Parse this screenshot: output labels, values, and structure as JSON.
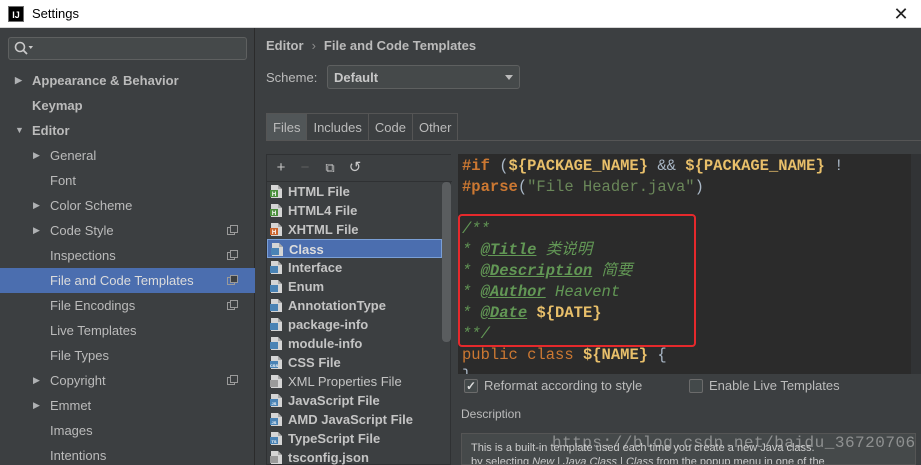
{
  "window": {
    "title": "Settings",
    "app_icon": "intellij-icon",
    "close_icon": "close-icon"
  },
  "search": {
    "placeholder": "",
    "icon": "search-icon"
  },
  "nav": {
    "items": [
      {
        "label": "Appearance & Behavior",
        "bold": true,
        "arrow": "right",
        "level": 0,
        "selected": false,
        "project_icon": false
      },
      {
        "label": "Keymap",
        "bold": true,
        "arrow": "",
        "level": 0,
        "selected": false,
        "project_icon": false
      },
      {
        "label": "Editor",
        "bold": true,
        "arrow": "down",
        "level": 0,
        "selected": false,
        "project_icon": false
      },
      {
        "label": "General",
        "bold": false,
        "arrow": "right",
        "level": 1,
        "selected": false,
        "project_icon": false
      },
      {
        "label": "Font",
        "bold": false,
        "arrow": "",
        "level": 1,
        "selected": false,
        "project_icon": false
      },
      {
        "label": "Color Scheme",
        "bold": false,
        "arrow": "right",
        "level": 1,
        "selected": false,
        "project_icon": false
      },
      {
        "label": "Code Style",
        "bold": false,
        "arrow": "right",
        "level": 1,
        "selected": false,
        "project_icon": true
      },
      {
        "label": "Inspections",
        "bold": false,
        "arrow": "",
        "level": 1,
        "selected": false,
        "project_icon": true
      },
      {
        "label": "File and Code Templates",
        "bold": false,
        "arrow": "",
        "level": 1,
        "selected": true,
        "project_icon": true
      },
      {
        "label": "File Encodings",
        "bold": false,
        "arrow": "",
        "level": 1,
        "selected": false,
        "project_icon": true
      },
      {
        "label": "Live Templates",
        "bold": false,
        "arrow": "",
        "level": 1,
        "selected": false,
        "project_icon": false
      },
      {
        "label": "File Types",
        "bold": false,
        "arrow": "",
        "level": 1,
        "selected": false,
        "project_icon": false
      },
      {
        "label": "Copyright",
        "bold": false,
        "arrow": "right",
        "level": 1,
        "selected": false,
        "project_icon": true
      },
      {
        "label": "Emmet",
        "bold": false,
        "arrow": "right",
        "level": 1,
        "selected": false,
        "project_icon": false
      },
      {
        "label": "Images",
        "bold": false,
        "arrow": "",
        "level": 1,
        "selected": false,
        "project_icon": false
      },
      {
        "label": "Intentions",
        "bold": false,
        "arrow": "",
        "level": 1,
        "selected": false,
        "project_icon": false
      }
    ]
  },
  "breadcrumb": {
    "part1": "Editor",
    "separator": "›",
    "part2": "File and Code Templates"
  },
  "scheme": {
    "label": "Scheme:",
    "value": "Default"
  },
  "tabs": [
    {
      "label": "Files",
      "active": true
    },
    {
      "label": "Includes",
      "active": false
    },
    {
      "label": "Code",
      "active": false
    },
    {
      "label": "Other",
      "active": false
    }
  ],
  "list_toolbar": {
    "add": "+",
    "remove": "−",
    "copy": "⧉",
    "reset": "↺"
  },
  "templates": [
    {
      "label": "HTML File",
      "icon": "html-file-icon",
      "color": "#4a8f3c",
      "tag": "H",
      "bold": true,
      "selected": false
    },
    {
      "label": "HTML4 File",
      "icon": "html4-file-icon",
      "color": "#4a8f3c",
      "tag": "H",
      "bold": true,
      "selected": false
    },
    {
      "label": "XHTML File",
      "icon": "xhtml-file-icon",
      "color": "#c9632d",
      "tag": "H",
      "bold": true,
      "selected": false
    },
    {
      "label": "Class",
      "icon": "class-file-icon",
      "color": "#4a83b5",
      "tag": "",
      "bold": true,
      "selected": true
    },
    {
      "label": "Interface",
      "icon": "interface-file-icon",
      "color": "#4a83b5",
      "tag": "",
      "bold": true,
      "selected": false
    },
    {
      "label": "Enum",
      "icon": "enum-file-icon",
      "color": "#4a83b5",
      "tag": "",
      "bold": true,
      "selected": false
    },
    {
      "label": "AnnotationType",
      "icon": "annotation-file-icon",
      "color": "#4a83b5",
      "tag": "",
      "bold": true,
      "selected": false
    },
    {
      "label": "package-info",
      "icon": "package-info-icon",
      "color": "#4a83b5",
      "tag": "",
      "bold": true,
      "selected": false
    },
    {
      "label": "module-info",
      "icon": "module-info-icon",
      "color": "#4a83b5",
      "tag": "",
      "bold": true,
      "selected": false
    },
    {
      "label": "CSS File",
      "icon": "css-file-icon",
      "color": "#4a83b5",
      "tag": "CSS",
      "bold": true,
      "selected": false
    },
    {
      "label": "XML Properties File",
      "icon": "xml-properties-file-icon",
      "color": "#9a9a9a",
      "tag": "",
      "bold": false,
      "selected": false
    },
    {
      "label": "JavaScript File",
      "icon": "javascript-file-icon",
      "color": "#4a83b5",
      "tag": "JS",
      "bold": true,
      "selected": false
    },
    {
      "label": "AMD JavaScript File",
      "icon": "amd-javascript-file-icon",
      "color": "#4a83b5",
      "tag": "JS",
      "bold": true,
      "selected": false
    },
    {
      "label": "TypeScript File",
      "icon": "typescript-file-icon",
      "color": "#4a83b5",
      "tag": "TS",
      "bold": true,
      "selected": false
    },
    {
      "label": "tsconfig.json",
      "icon": "json-file-icon",
      "color": "#9a9a9a",
      "tag": "",
      "bold": true,
      "selected": false
    }
  ],
  "editor": {
    "line1": {
      "kw": "#if",
      "p1": " (",
      "v1": "${PACKAGE_NAME}",
      "p2": " && ",
      "v2": "${PACKAGE_NAME}",
      "p3": " !"
    },
    "line2": {
      "kw": "#parse",
      "p1": "(",
      "str": "\"File Header.java\"",
      "p2": ")"
    },
    "line3": {
      "text": "/**"
    },
    "line4": {
      "star": "* ",
      "tag": "@Title",
      "text": " 类说明"
    },
    "line5": {
      "star": "* ",
      "tag": "@Description",
      "text": " 简要"
    },
    "line6": {
      "star": "* ",
      "tag": "@Author",
      "text": " Heavent"
    },
    "line7": {
      "star": "* ",
      "tag": "@Date",
      "sp": " ",
      "var": "${DATE}"
    },
    "line8": {
      "text": "**/"
    },
    "line9": {
      "kw1": "public",
      "sp": " ",
      "kw2": "class",
      "sp2": " ",
      "var": "${NAME}",
      "brace": " {"
    },
    "line10": {
      "text": "}"
    }
  },
  "options": {
    "reformat": {
      "label": "Reformat according to style",
      "checked": true
    },
    "live_templates": {
      "label": "Enable Live Templates",
      "checked": false
    }
  },
  "description": {
    "label": "Description",
    "line1": "This is a built-in template used each time you create a new Java class.",
    "line2a": "by selecting ",
    "line2b": "New",
    "line2c": " | ",
    "line2d": "Java Class",
    "line2e": " | ",
    "line2f": "Class",
    "line2g": " from the popup menu in one of the"
  },
  "watermark": "https://blog.csdn.net/baidu_36720706"
}
